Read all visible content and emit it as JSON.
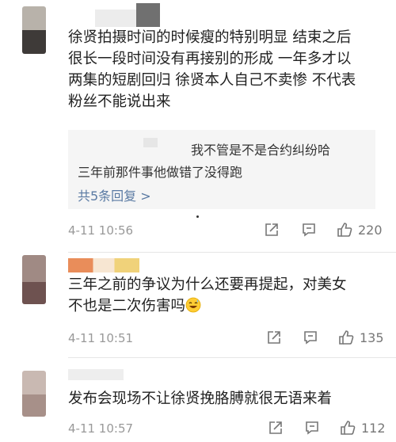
{
  "comments": [
    {
      "text_lines": [
        "徐贤拍摄时间的时候瘦的特别明显 结束之后",
        "很长一段时间没有再接别的形成 一年多才以",
        "两集的短剧回归 徐贤本人自己不卖惨 不代表",
        "粉丝不能说出来"
      ],
      "replies": [
        "我不管是不是合约纠纷哈",
        "三年前那件事他做错了没得跑"
      ],
      "more_replies": "共5条回复 >",
      "time": "4-11 10:56",
      "likes": "220"
    },
    {
      "text_lines": [
        "三年之前的争议为什么还要再提起，对美女",
        "不也是二次伤害吗"
      ],
      "time": "4-11 10:51",
      "likes": "135"
    },
    {
      "text_lines": [
        "发布会现场不让徐贤挽胳膊就很无语来着"
      ],
      "time": "4-11 10:57",
      "likes": "112"
    }
  ],
  "icons": {
    "share": "share-icon",
    "comment": "comment-icon",
    "like": "thumbs-up-icon",
    "emoji": "sweat-smile-emoji-icon"
  },
  "colors": {
    "link": "#5a7aa3",
    "meta": "#999999",
    "reply_bg": "#f5f5f5"
  }
}
